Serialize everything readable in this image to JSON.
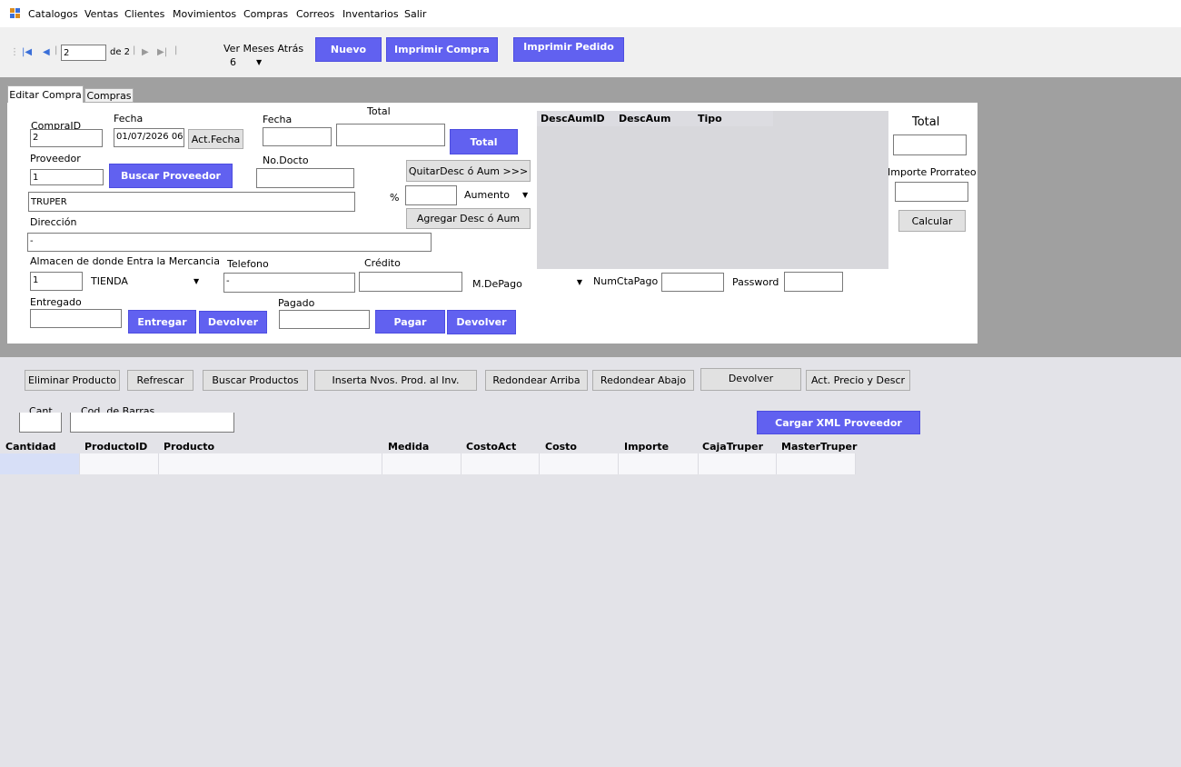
{
  "menu": {
    "items": [
      "Catalogos",
      "Ventas",
      "Clientes",
      "Movimientos",
      "Compras",
      "Correos",
      "Inventarios",
      "Salir"
    ]
  },
  "toolbar": {
    "position_value": "2",
    "of_label": "de 2",
    "months_label": "Ver Meses Atrás",
    "months_value": "6",
    "nuevo": "Nuevo",
    "imprimir_compra": "Imprimir Compra",
    "imprimir_pedido": "Imprimir Pedido"
  },
  "tabs": [
    "Editar Compra",
    "Compras"
  ],
  "form": {
    "compraid_label": "CompraID",
    "compraid_value": "2",
    "fecha_label": "Fecha",
    "fecha_value": "01/07/2026 06",
    "actfecha": "Act.Fecha",
    "fecha2_label": "Fecha",
    "fecha2_value": "",
    "total_label": "Total",
    "total_value": "",
    "total_button": "Total",
    "proveedor_label": "Proveedor",
    "proveedor_value": "1",
    "buscar_proveedor": "Buscar Proveedor",
    "nodocto_label": "No.Docto",
    "nodocto_value": "",
    "proveedor_name": "TRUPER",
    "quitar": "QuitarDesc ó Aum >>>",
    "percent_label": "%",
    "percent_value": "",
    "aumento": "Aumento",
    "agregar": "Agregar Desc ó Aum",
    "direccion_label": "Dirección",
    "direccion_value": "-",
    "almacen_label": "Almacen de donde Entra la Mercancia",
    "almacen_id": "1",
    "almacen_name": "TIENDA",
    "telefono_label": "Telefono",
    "telefono_value": "-",
    "credito_label": "Crédito",
    "credito_value": "",
    "mdepago_label": "M.DePago",
    "mdepago_value": "",
    "numcta_label": "NumCtaPago",
    "numcta_value": "",
    "password_label": "Password",
    "password_value": "",
    "entregado_label": "Entregado",
    "entregado_value": "",
    "entregar": "Entregar",
    "devolver1": "Devolver",
    "pagado_label": "Pagado",
    "pagado_value": "",
    "pagar": "Pagar",
    "devolver2": "Devolver"
  },
  "desc_grid": {
    "columns": [
      "DescAumID",
      "DescAum",
      "Tipo"
    ]
  },
  "right_panel": {
    "total_label": "Total",
    "total_value": "",
    "importe_label": "Importe Prorrateo",
    "importe_value": "",
    "calcular": "Calcular"
  },
  "actions": {
    "eliminar": "Eliminar Producto",
    "refrescar": "Refrescar",
    "buscar": "Buscar Productos",
    "inserta": "Inserta Nvos. Prod. al Inv.",
    "redondear_arriba": "Redondear Arriba",
    "redondear_abajo": "Redondear Abajo",
    "devolver": "Devolver",
    "act_precio": "Act. Precio y Descr"
  },
  "scan": {
    "cant_label": "Cant.",
    "cant_value": "",
    "codbarras_label": "Cod. de Barras",
    "codbarras_value": "",
    "cargar_xml": "Cargar XML Proveedor"
  },
  "products_grid": {
    "columns": [
      "Cantidad",
      "ProductoID",
      "Producto",
      "Medida",
      "CostoAct",
      "Costo",
      "Importe",
      "CajaTruper",
      "MasterTruper"
    ]
  }
}
